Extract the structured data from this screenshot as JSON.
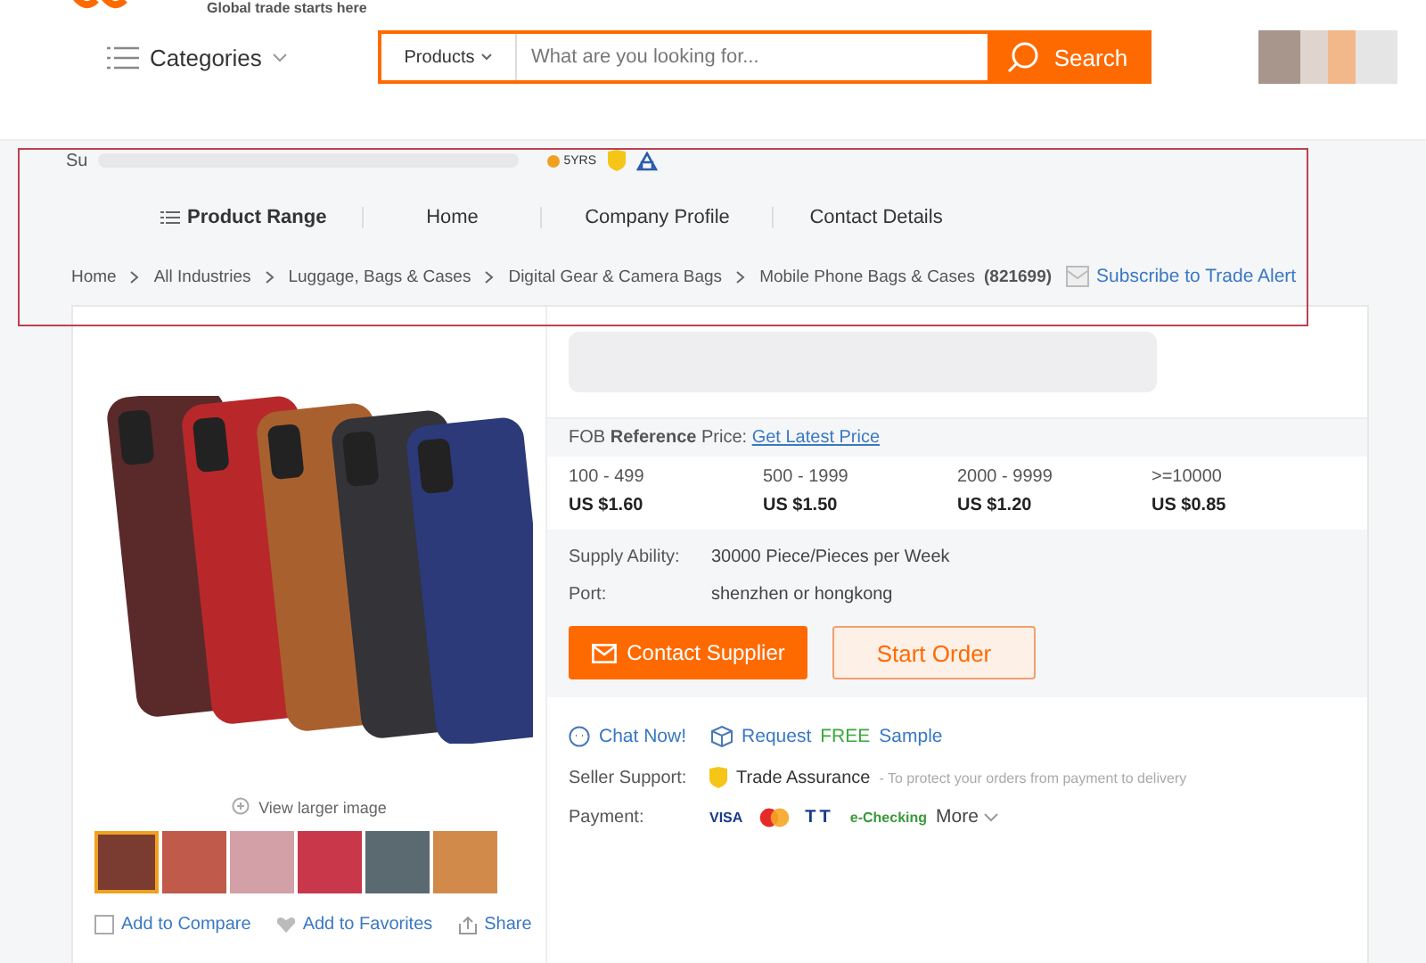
{
  "header": {
    "tagline": "Global trade starts here",
    "categories": "Categories",
    "search": {
      "scope": "Products",
      "placeholder": "What are you looking for...",
      "button": "Search"
    }
  },
  "supplier": {
    "name_prefix": "Su",
    "years": "5YRS"
  },
  "nav": [
    {
      "label": "Product Range",
      "selected": true
    },
    {
      "label": "Home",
      "selected": false
    },
    {
      "label": "Company Profile",
      "selected": false
    },
    {
      "label": "Contact Details",
      "selected": false
    }
  ],
  "breadcrumb": {
    "items": [
      "Home",
      "All Industries",
      "Luggage, Bags & Cases",
      "Digital Gear & Camera Bags",
      "Mobile Phone Bags & Cases"
    ],
    "count": "(821699)",
    "subscribe": "Subscribe to Trade Alert"
  },
  "gallery": {
    "view_larger": "View larger image",
    "thumbnails": [
      {
        "selected": true
      },
      {
        "selected": false
      },
      {
        "selected": false
      },
      {
        "selected": false
      },
      {
        "selected": false
      },
      {
        "selected": false
      }
    ],
    "actions": [
      "Add to Compare",
      "Add to Favorites",
      "Share"
    ],
    "compare_checked": false
  },
  "price": {
    "fob": "FOB **Reference** Price:",
    "latest": "Get Latest Price",
    "tiers": [
      {
        "qty": "100 - 499",
        "price": "US $1.60"
      },
      {
        "qty": "500 - 1999",
        "price": "US $1.50"
      },
      {
        "qty": "2000 - 9999",
        "price": "US $1.20"
      },
      {
        "qty": ">=10000",
        "price": "US $0.85"
      }
    ]
  },
  "details": [
    {
      "label": "Supply Ability:",
      "value": "30000 Piece/Pieces per Week"
    },
    {
      "label": "Port:",
      "value": "shenzhen or hongkong"
    }
  ],
  "buttons": {
    "contact": "Contact Supplier",
    "order": "Start Order"
  },
  "links": {
    "chat": "Chat Now!",
    "request": "Request",
    "free": "FREE",
    "sample": "Sample"
  },
  "seller_support": {
    "label": "Seller Support:",
    "name": "Trade Assurance",
    "note": "- To protect your orders from payment to delivery"
  },
  "payment": {
    "label": "Payment:",
    "methods": [
      "VISA",
      "TT",
      "e-Checking"
    ],
    "more": "More"
  }
}
